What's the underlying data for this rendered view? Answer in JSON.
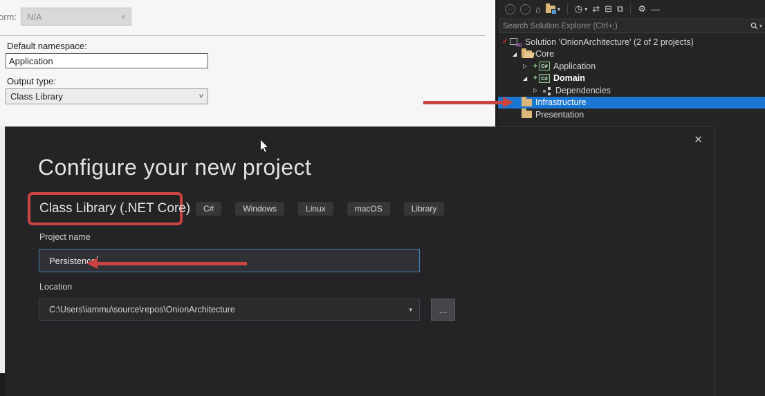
{
  "icons": {
    "back": "←",
    "forward": "→",
    "home": "⌂",
    "clock": "◷",
    "sync": "⇄",
    "collapse_all": "⊟",
    "show_all_files": "⧉",
    "wrench": "⚙",
    "preview_dash": "—",
    "caret_down": "▾",
    "combo_caret": "▾",
    "select_caret": "˅",
    "close": "✕",
    "expanded": "◢",
    "collapsed": "▷",
    "plus": "+",
    "check": "✓",
    "infinity": "∞",
    "csharp_badge": "C#",
    "ellipsis": "…"
  },
  "colors": {
    "selection_blue": "#1a77d4",
    "folder_tan": "#dcb67a",
    "annotation_red": "#cb4440"
  },
  "properties_pane": {
    "platform_label_clipped": "orm:",
    "platform_value": "N/A",
    "default_namespace_label": "Default namespace:",
    "default_namespace_value": "Application",
    "output_type_label": "Output type:",
    "output_type_value": "Class Library"
  },
  "solution_explorer": {
    "search_placeholder": "Search Solution Explorer (Ctrl+;)",
    "toolbar": [
      {
        "name": "back-icon",
        "glyph": "back",
        "circle": true,
        "disabled": true
      },
      {
        "name": "forward-icon",
        "glyph": "forward",
        "circle": true,
        "disabled": true
      },
      {
        "name": "home-icon",
        "glyph": "home"
      },
      {
        "name": "switch-views-icon",
        "folder": true,
        "caret": true
      },
      {
        "name": "separator",
        "sep": true
      },
      {
        "name": "pending-changes-filter-icon",
        "glyph": "clock",
        "caret": true
      },
      {
        "name": "sync-with-active-document-icon",
        "glyph": "sync"
      },
      {
        "name": "collapse-all-icon",
        "glyph": "collapse_all"
      },
      {
        "name": "show-all-files-icon",
        "glyph": "show_all_files"
      },
      {
        "name": "separator",
        "sep": true
      },
      {
        "name": "properties-wrench-icon",
        "glyph": "wrench"
      },
      {
        "name": "preview-selected-items-icon",
        "glyph": "preview_dash"
      }
    ],
    "tree": [
      {
        "label": "Solution 'OnionArchitecture' (2 of 2 projects)",
        "icon": "solution",
        "check": true,
        "indent": 0
      },
      {
        "label": "Core",
        "icon": "folder-open",
        "expander": "expanded",
        "indent": 1
      },
      {
        "label": "Application",
        "icon": "csharp",
        "plus": true,
        "expander": "collapsed",
        "indent": 2
      },
      {
        "label": "Domain",
        "icon": "csharp",
        "plus": true,
        "expander": "expanded",
        "indent": 2,
        "bold": true
      },
      {
        "label": "Dependencies",
        "icon": "dependencies",
        "expander": "collapsed",
        "indent": 3
      },
      {
        "label": "Infrastructure",
        "icon": "folder",
        "indent": 1,
        "selected": true
      },
      {
        "label": "Presentation",
        "icon": "folder",
        "indent": 1
      }
    ]
  },
  "dialog": {
    "title": "Configure your new project",
    "template_name": "Class Library (.NET Core)",
    "tags": [
      "C#",
      "Windows",
      "Linux",
      "macOS",
      "Library"
    ],
    "project_name_label": "Project name",
    "project_name_value": "Persistence",
    "location_label": "Location",
    "location_value": "C:\\Users\\iammu\\source\\repos\\OnionArchitecture",
    "browse_button_label": "…"
  }
}
